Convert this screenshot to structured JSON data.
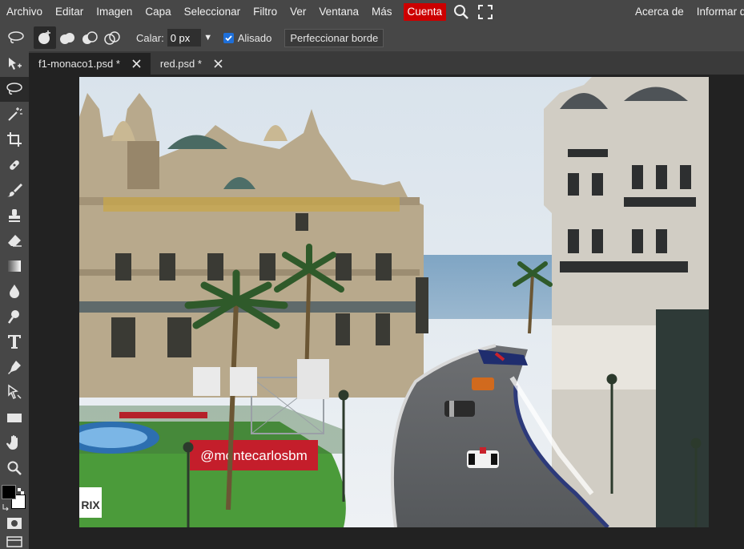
{
  "menu": {
    "items": [
      "Archivo",
      "Editar",
      "Imagen",
      "Capa",
      "Seleccionar",
      "Filtro",
      "Ver",
      "Ventana",
      "Más"
    ],
    "account_label": "Cuenta",
    "right_items": [
      "Acerca de",
      "Informar de"
    ]
  },
  "options": {
    "feather_label": "Calar:",
    "feather_value": "0 px",
    "antialias_label": "Alisado",
    "antialias_checked": true,
    "refine_label": "Perfeccionar borde"
  },
  "tabs": [
    {
      "label": "f1-monaco1.psd *",
      "active": true
    },
    {
      "label": "red.psd *",
      "active": false
    }
  ],
  "canvas": {
    "banner_text": "@montecarlosbm",
    "side_banner_text": "RIX"
  },
  "colors": {
    "foreground": "#000000",
    "background": "#ffffff",
    "account_bg": "#cc0000",
    "panel_bg": "#474747"
  },
  "toolbar": {
    "tools": [
      "move-tool",
      "lasso-tool",
      "magic-wand-tool",
      "crop-tool",
      "healing-tool",
      "brush-tool",
      "stamp-tool",
      "eraser-tool",
      "gradient-tool",
      "blur-tool",
      "dodge-tool",
      "text-tool",
      "pen-tool",
      "path-select-tool",
      "shape-tool",
      "hand-tool",
      "zoom-tool"
    ],
    "active_tool": "lasso-tool"
  }
}
